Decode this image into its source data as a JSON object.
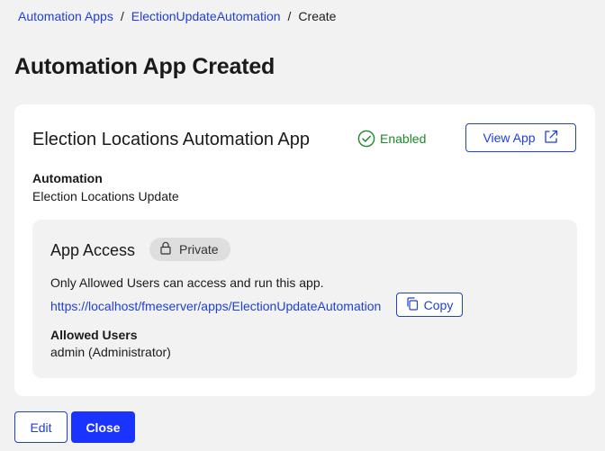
{
  "breadcrumb": {
    "items": [
      "Automation Apps",
      "ElectionUpdateAutomation"
    ],
    "separator": "/",
    "current": "Create"
  },
  "page": {
    "title": "Automation App Created"
  },
  "app": {
    "name": "Election Locations Automation App",
    "status": "Enabled",
    "status_icon": "check-circle-icon",
    "view_button": "View App",
    "view_icon": "external-link-icon",
    "automation_label": "Automation",
    "automation_value": "Election Locations Update"
  },
  "access": {
    "title": "App Access",
    "badge": "Private",
    "badge_icon": "lock-icon",
    "description": "Only Allowed Users can access and run this app.",
    "url": "https://localhost/fmeserver/apps/ElectionUpdateAutomation",
    "copy_button": "Copy",
    "copy_icon": "copy-icon",
    "allowed_label": "Allowed Users",
    "allowed_value": "admin (Administrator)"
  },
  "footer": {
    "edit_button": "Edit",
    "close_button": "Close"
  },
  "colors": {
    "link": "#1f3fd6",
    "primary": "#1a33ff",
    "success": "#1a8a2a",
    "background": "#f2f2f2",
    "card": "#ffffff",
    "badge": "#dedede"
  }
}
